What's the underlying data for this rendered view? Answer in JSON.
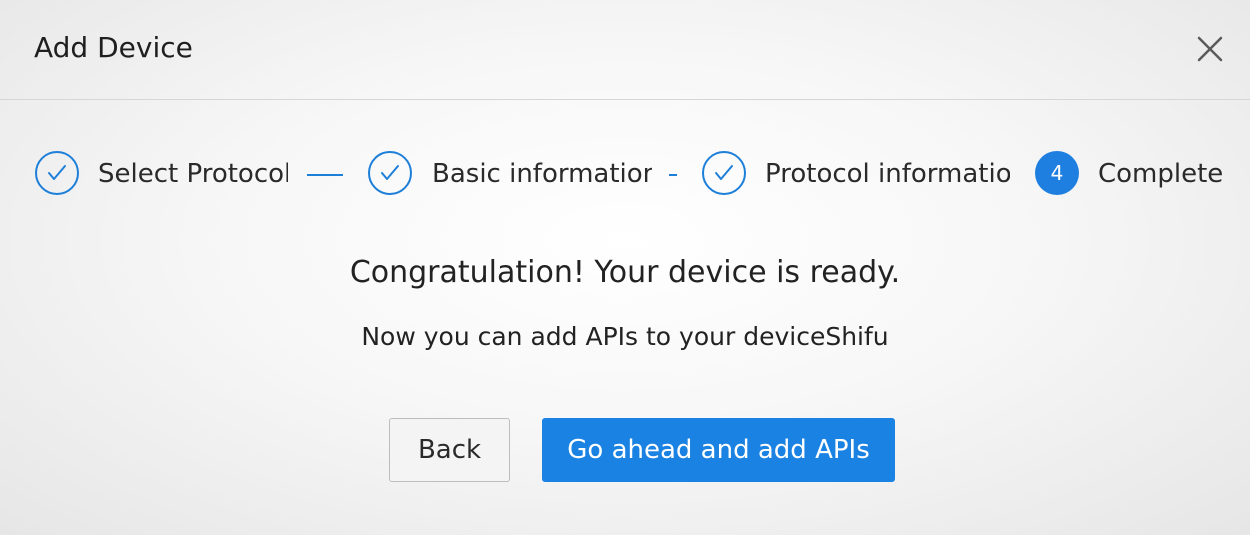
{
  "dialog": {
    "title": "Add Device",
    "close_icon": "close-icon"
  },
  "steps": [
    {
      "label": "Select Protocol",
      "status": "done",
      "icon": "check-icon"
    },
    {
      "label": "Basic information",
      "status": "done",
      "icon": "check-icon"
    },
    {
      "label": "Protocol information",
      "status": "done",
      "icon": "check-icon"
    },
    {
      "label": "Complete",
      "status": "active",
      "number": "4"
    }
  ],
  "content": {
    "heading": "Congratulation! Your device is ready.",
    "subtext": "Now you can add APIs to your deviceShifu"
  },
  "buttons": {
    "back": "Back",
    "primary": "Go ahead and add APIs"
  },
  "colors": {
    "accent": "#1a82e2",
    "step_line": "#1e7fd9",
    "text": "#222222"
  }
}
